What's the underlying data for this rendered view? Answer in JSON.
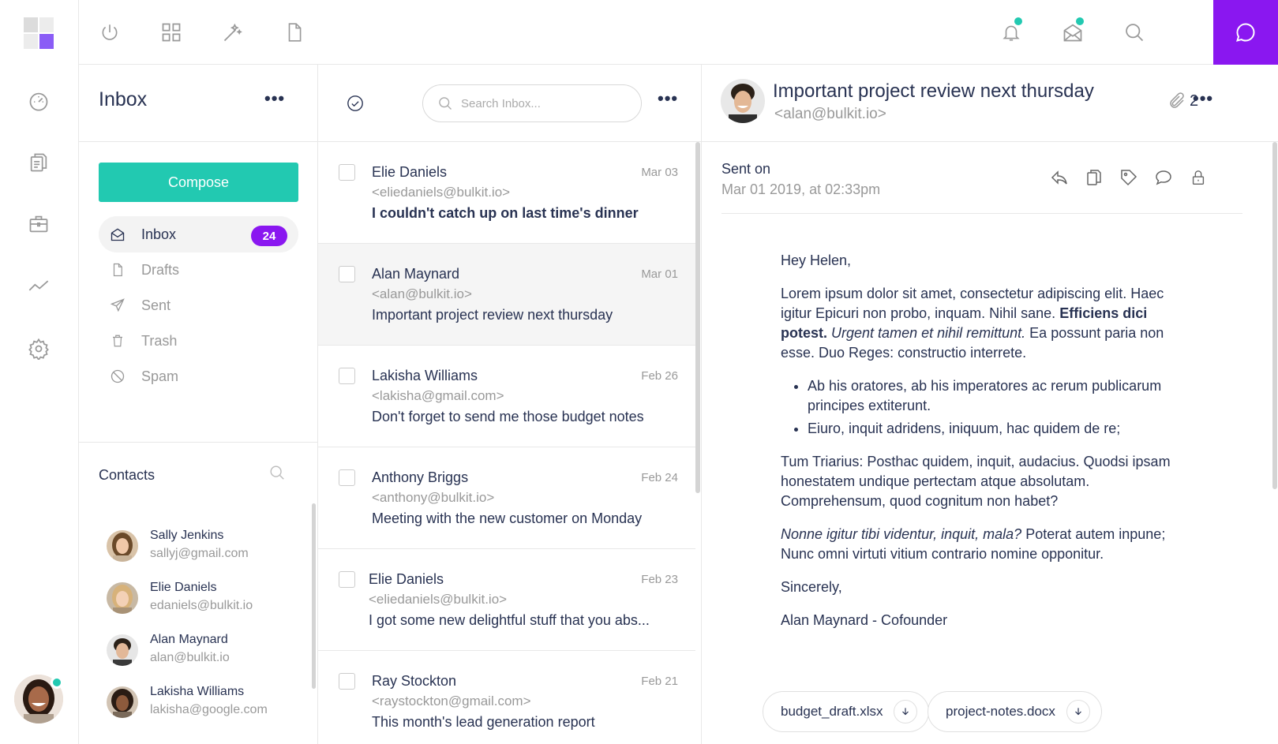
{
  "colors": {
    "accent": "#8a17f0",
    "teal": "#22c9b1",
    "text": "#283252",
    "muted": "#999999"
  },
  "rail": {
    "icons": [
      "dashboard-icon",
      "documents-icon",
      "briefcase-icon",
      "analytics-icon",
      "settings-icon"
    ]
  },
  "topbar": {
    "icons": [
      "power-icon",
      "grid-icon",
      "magic-wand-icon",
      "file-icon",
      "bell-icon",
      "mail-open-icon",
      "search-icon",
      "chat-icon"
    ]
  },
  "folders": {
    "title": "Inbox",
    "compose_label": "Compose",
    "items": [
      {
        "label": "Inbox",
        "icon": "inbox-icon",
        "count": "24"
      },
      {
        "label": "Drafts",
        "icon": "file-icon"
      },
      {
        "label": "Sent",
        "icon": "send-icon"
      },
      {
        "label": "Trash",
        "icon": "trash-icon"
      },
      {
        "label": "Spam",
        "icon": "block-icon"
      }
    ]
  },
  "contacts": {
    "title": "Contacts",
    "items": [
      {
        "name": "Sally Jenkins",
        "email": "sallyj@gmail.com"
      },
      {
        "name": "Elie Daniels",
        "email": "edaniels@bulkit.io"
      },
      {
        "name": "Alan Maynard",
        "email": "alan@bulkit.io"
      },
      {
        "name": "Lakisha Williams",
        "email": "lakisha@google.com"
      }
    ]
  },
  "list": {
    "search_placeholder": "Search Inbox...",
    "messages": [
      {
        "name": "Elie Daniels",
        "email": "<eliedaniels@bulkit.io>",
        "subject": "I couldn't catch up on last time's dinner",
        "date": "Mar 03",
        "unread": true
      },
      {
        "name": "Alan Maynard",
        "email": "<alan@bulkit.io>",
        "subject": "Important project review next thursday",
        "date": "Mar 01",
        "selected": true
      },
      {
        "name": "Lakisha Williams",
        "email": "<lakisha@gmail.com>",
        "subject": "Don't forget to send me those budget notes",
        "date": "Feb 26"
      },
      {
        "name": "Anthony Briggs",
        "email": "<anthony@bulkit.io>",
        "subject": "Meeting with the new customer on Monday",
        "date": "Feb 24"
      },
      {
        "name": "Elie Daniels",
        "email": "<eliedaniels@bulkit.io>",
        "subject": "I got some new delightful stuff that you abs...",
        "date": "Feb 23"
      },
      {
        "name": "Ray Stockton",
        "email": "<raystockton@gmail.com>",
        "subject": "This month's lead generation report",
        "date": "Feb 21"
      }
    ]
  },
  "reader": {
    "subject": "Important project review next thursday",
    "sender_email": "<alan@bulkit.io>",
    "attachment_count": "2",
    "sent_label": "Sent on",
    "sent_date": "Mar 01 2019, at 02:33pm",
    "actions": [
      "reply-icon",
      "copy-icon",
      "tag-icon",
      "comment-icon",
      "lock-icon"
    ],
    "greeting": "Hey Helen,",
    "p1_a": "Lorem ipsum dolor sit amet, consectetur adipiscing elit. Haec igitur Epicuri non probo, inquam. Nihil sane.",
    "p1_bold": "Efficiens dici potest.",
    "p1_italic": "Urgent tamen et nihil remittunt.",
    "p1_b": "Ea possunt paria non esse. Duo Reges: constructio interrete.",
    "bullets": [
      "Ab his oratores, ab his imperatores ac rerum publicarum principes extiterunt.",
      "Eiuro, inquit adridens, iniquum, hac quidem de re;"
    ],
    "p2": "Tum Triarius: Posthac quidem, inquit, audacius. Quodsi ipsam honestatem undique pertectam atque absolutam. Comprehensum, quod cognitum non habet?",
    "p3_italic": "Nonne igitur tibi videntur, inquit, mala?",
    "p3_b": "Poterat autem inpune; Nunc omni virtuti vitium contrario nomine opponitur.",
    "closing": "Sincerely,",
    "signature": "Alan Maynard - Cofounder",
    "attachments": [
      "budget_draft.xlsx",
      "project-notes.docx"
    ]
  }
}
